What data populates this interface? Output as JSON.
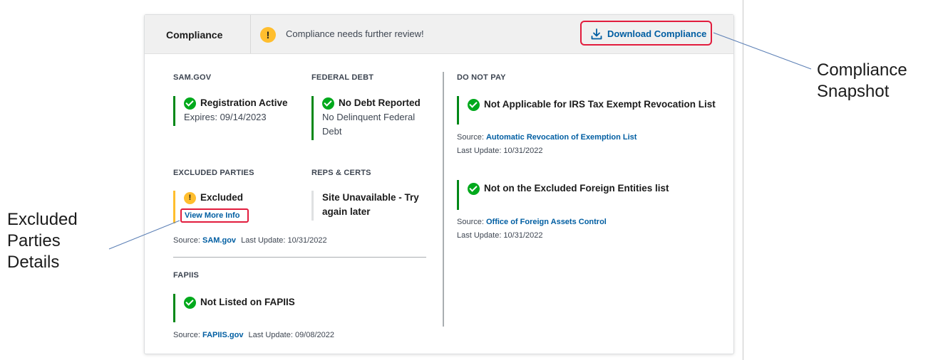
{
  "header": {
    "title": "Compliance",
    "message": "Compliance needs further review!",
    "download_label": "Download Compliance"
  },
  "sam": {
    "label": "SAM.GOV",
    "status": "Registration Active",
    "detail": "Expires: 09/14/2023"
  },
  "federal_debt": {
    "label": "FEDERAL DEBT",
    "status": "No Debt Reported",
    "detail_line1": "No Delinquent Federal",
    "detail_line2": "Debt"
  },
  "excluded": {
    "label": "EXCLUDED PARTIES",
    "status": "Excluded",
    "view_more": "View More Info",
    "source_prefix": "Source:",
    "source_link": "SAM.gov",
    "last_update": "Last Update: 10/31/2022"
  },
  "reps": {
    "label": "REPS & CERTS",
    "status_line1": "Site Unavailable - Try",
    "status_line2": "again later"
  },
  "fapiis": {
    "label": "FAPIIS",
    "status": "Not Listed on FAPIIS",
    "source_prefix": "Source:",
    "source_link": "FAPIIS.gov",
    "last_update": "Last Update: 09/08/2022"
  },
  "do_not_pay": {
    "label": "DO NOT PAY",
    "item1": {
      "status": "Not Applicable for IRS Tax Exempt Revocation List",
      "source_prefix": "Source:",
      "source_link": "Automatic Revocation of Exemption List",
      "last_update": "Last Update: 10/31/2022"
    },
    "item2": {
      "status": "Not on the Excluded Foreign Entities list",
      "source_prefix": "Source:",
      "source_link": "Office of Foreign Assets Control",
      "last_update": "Last Update: 10/31/2022"
    }
  },
  "annotations": {
    "snapshot_line1": "Compliance",
    "snapshot_line2": "Snapshot",
    "excluded_line1": "Excluded",
    "excluded_line2": "Parties",
    "excluded_line3": "Details"
  },
  "colors": {
    "accent_link": "#005ea2",
    "success": "#00a91c",
    "warning": "#ffbe2e",
    "highlight_red": "#e21c3d"
  }
}
